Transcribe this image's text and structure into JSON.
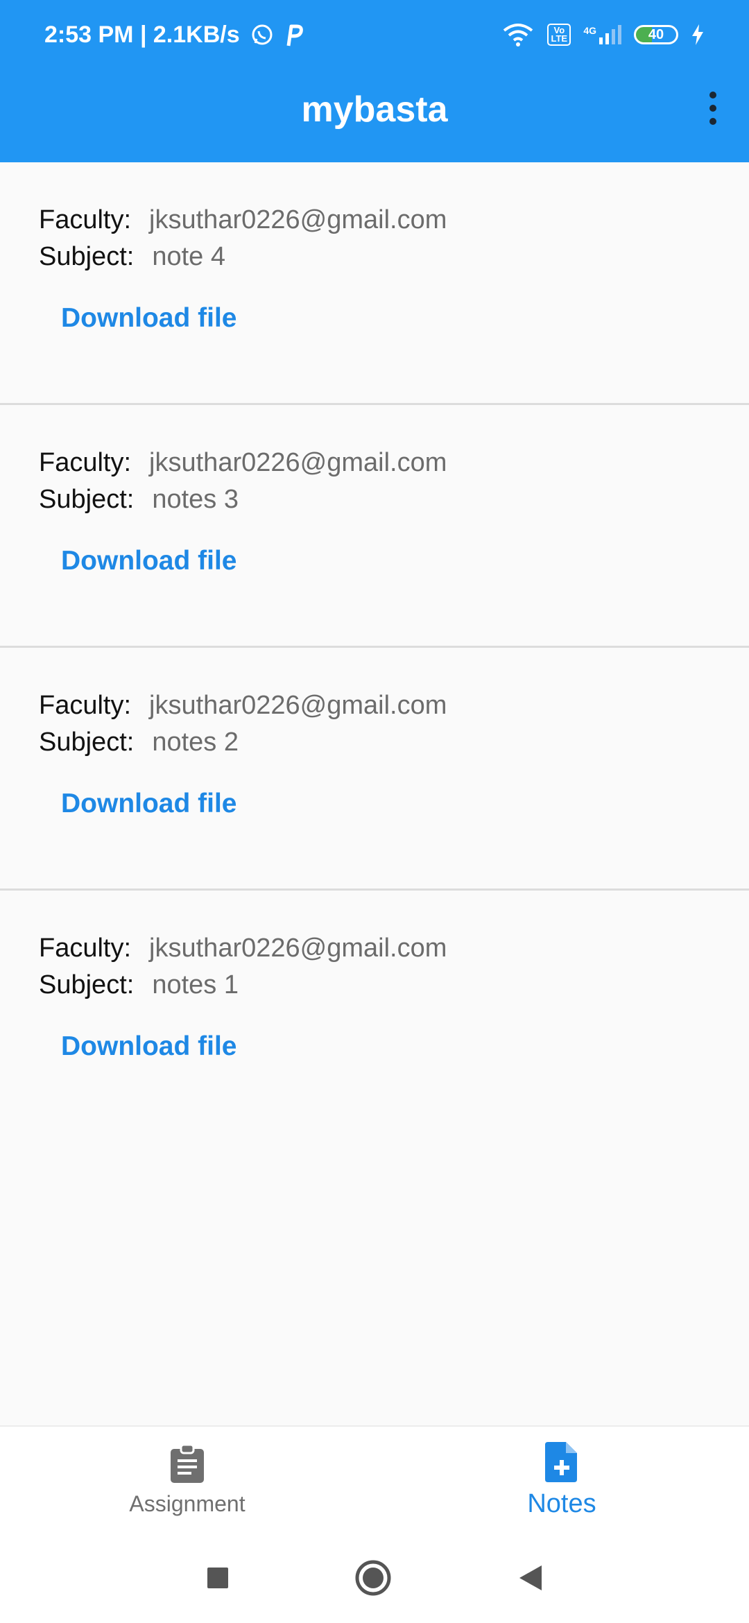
{
  "status_bar": {
    "time": "2:53 PM | 2.1KB/s",
    "network": "4G",
    "battery": "40",
    "lte": "Vo LTE"
  },
  "app_bar": {
    "title": "mybasta"
  },
  "labels": {
    "faculty": "Faculty:",
    "subject": "Subject:",
    "download": "Download file"
  },
  "notes": [
    {
      "faculty": "jksuthar0226@gmail.com",
      "subject": "note 4"
    },
    {
      "faculty": "jksuthar0226@gmail.com",
      "subject": "notes 3"
    },
    {
      "faculty": "jksuthar0226@gmail.com",
      "subject": "notes 2"
    },
    {
      "faculty": "jksuthar0226@gmail.com",
      "subject": "notes 1"
    }
  ],
  "bottom_nav": [
    {
      "label": "Assignment",
      "icon": "assignment-icon",
      "active": false
    },
    {
      "label": "Notes",
      "icon": "note-add-icon",
      "active": true
    }
  ],
  "colors": {
    "primary": "#2196f3",
    "accent": "#1e88e5"
  }
}
